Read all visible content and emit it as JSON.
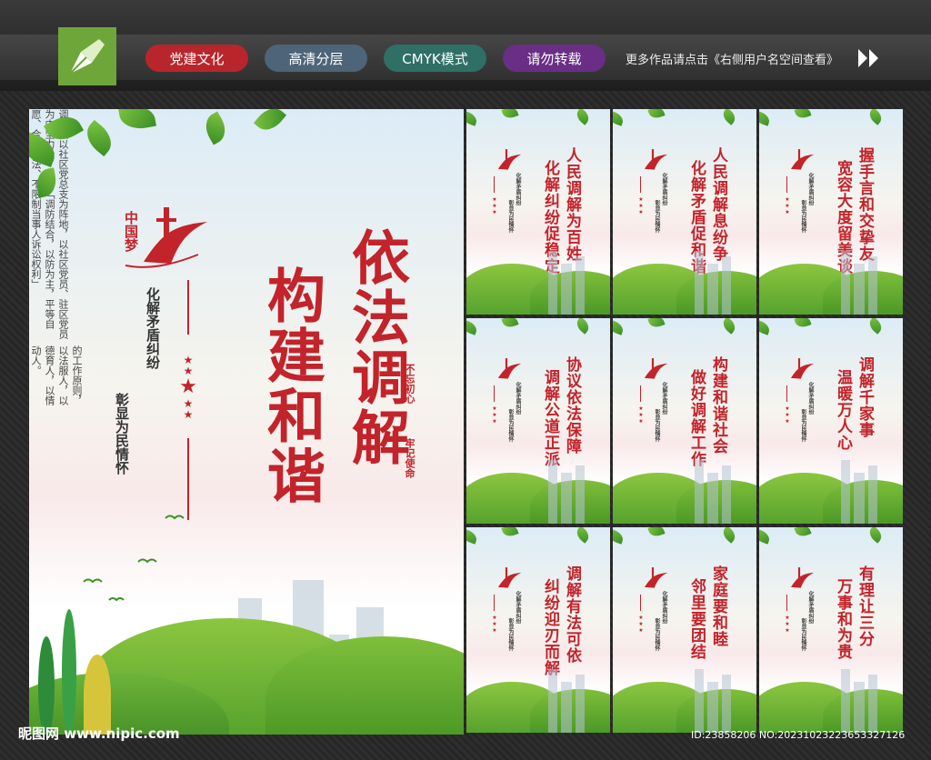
{
  "header": {
    "tags": [
      "党建文化",
      "高清分层",
      "CMYK模式",
      "请勿转载"
    ],
    "more_text": "更多作品请点击《右侧用户名空间查看》"
  },
  "main_poster": {
    "emblem_text": "中国梦",
    "title_line1": "依法调解",
    "title_line2": "构建和谐",
    "subtitle_line1": "化解矛盾纠纷",
    "subtitle_line2": "彰显为民情怀",
    "body_col1": "调解室以社区党总支为阵地，以社区党员、驻区党员为中坚力量，坚持「调防结合，以防为主，平等自愿、合理合法、不限制当事人诉讼权利」",
    "body_col2": "的工作原则，以法服人，以德育人，以情动人。",
    "seal_line1": "不忘初心",
    "seal_line2": "牢记使命"
  },
  "small_posters": [
    {
      "title1": "人民调解为百姓",
      "title2": "化解纠纷促稳定"
    },
    {
      "title1": "人民调解息纷争",
      "title2": "化解矛盾促和谐"
    },
    {
      "title1": "握手言和交挚友",
      "title2": "宽容大度留美谈"
    },
    {
      "title1": "协议依法保障",
      "title2": "调解公道正派"
    },
    {
      "title1": "构建和谐社会",
      "title2": "做好调解工作"
    },
    {
      "title1": "调解千家事",
      "title2": "温暖万人心"
    },
    {
      "title1": "调解有法可依",
      "title2": "纠纷迎刃而解"
    },
    {
      "title1": "家庭要和睦",
      "title2": "邻里要团结"
    },
    {
      "title1": "有理让三分",
      "title2": "万事和为贵"
    }
  ],
  "small_common": {
    "sub1": "化解矛盾纠纷",
    "sub2": "彰显为民情怀"
  },
  "footer": {
    "watermark": "昵图网 www.nipic.com",
    "id_text": "ID:23858206 NO:20231023223653327126"
  },
  "colors": {
    "brand_red": "#c3232a",
    "tag_red": "#b8262b",
    "tag_slate": "#4e6478",
    "tag_teal": "#2f6f66",
    "tag_purple": "#6a2e86"
  }
}
